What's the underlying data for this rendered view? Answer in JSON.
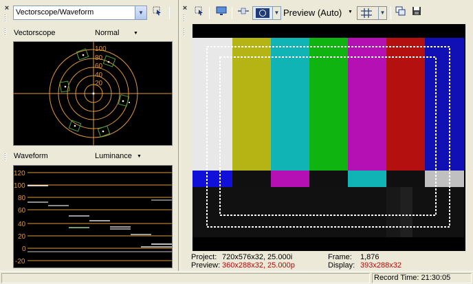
{
  "left_panel": {
    "scope_selector": {
      "value": "Vectorscope/Waveform"
    },
    "vectorscope": {
      "label": "Vectorscope",
      "mode": "Normal",
      "ring_labels": [
        "100",
        "80",
        "60",
        "40",
        "20"
      ]
    },
    "waveform": {
      "label": "Waveform",
      "mode": "Luminance",
      "scale_labels": [
        "120",
        "100",
        "80",
        "60",
        "40",
        "20",
        "0",
        "-20"
      ]
    }
  },
  "preview_panel": {
    "quality": "Preview (Auto)",
    "status": {
      "project_label": "Project:",
      "project_value": "720x576x32, 25.000i",
      "preview_label": "Preview:",
      "preview_value": "360x288x32, 25.000p",
      "frame_label": "Frame:",
      "frame_value": "1,876",
      "display_label": "Display:",
      "display_value": "393x288x32"
    }
  },
  "status_bar": {
    "record_time": "Record Time: 21:30:05"
  },
  "colors": {
    "scope_trace": "#e39a38",
    "vector_target": "#4aa84a",
    "status_red": "#c00000",
    "bars": [
      "#e8e8e8",
      "#b4b414",
      "#10b4b4",
      "#10b410",
      "#b410b4",
      "#b41010",
      "#1010b4"
    ],
    "bottom_strip": [
      "#1010d8",
      "#101010",
      "#b410b4",
      "#101010",
      "#10b4b4",
      "#101010",
      "#c0c0c0"
    ]
  }
}
